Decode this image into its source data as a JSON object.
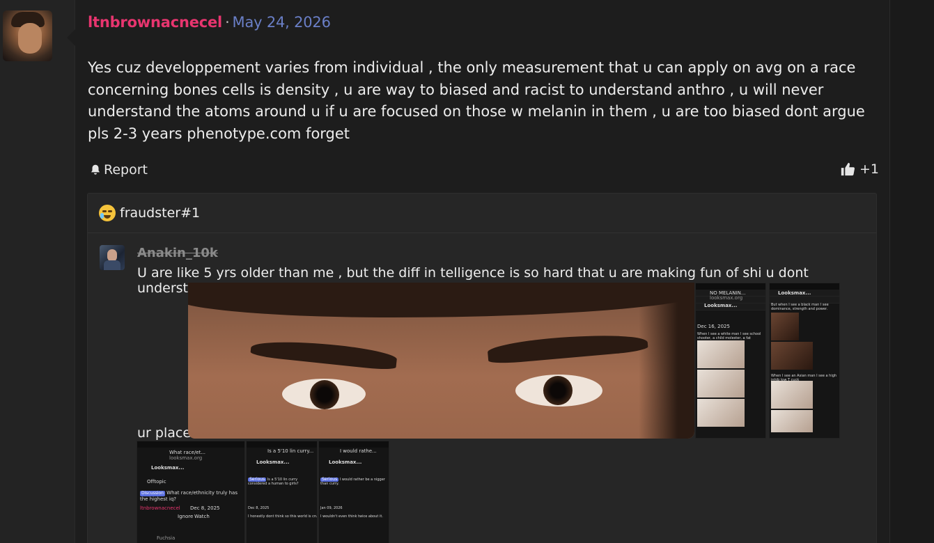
{
  "post": {
    "username": "ltnbrownacnecel",
    "separator": "·",
    "date": "May 24, 2026",
    "body": "Yes cuz developpement varies from individual , the only measurement that u can apply on avg on a race concerning bones cells is density , u are way to biased and racist to understand anthro , u will never understand the atoms around u if u are focused on those w melanin in them , u are too biased dont argue pls 2-3 years phenotype.com forget",
    "report_label": "Report",
    "like_count": "+1"
  },
  "quote": {
    "title": "fraudster#1",
    "author": "Anakin_10k",
    "text_line1": "U are like 5 yrs older than me , but the diff in telligence is so hard that u are making fun of shi u dont understand , know",
    "text_line2": "ur place"
  },
  "screenshots": {
    "p1": {
      "title": "NO MELANIN...",
      "site": "looksmax.org",
      "logo": "Looksmax...",
      "date": "Dec 16, 2025",
      "caption": "When I see a white man I see school shooter, a child molester, a fat disgusting cuck"
    },
    "p2": {
      "logo": "Looksmax...",
      "caption1": "But when I see a black man I see dominance, strength and power.",
      "caption2": "When I see an Asian man I see a high inhib low T cuck"
    },
    "p3": {
      "title": "What race/et...",
      "site": "looksmax.org",
      "logo": "Looksmax...",
      "back": "Offtopic",
      "tag": "Discussion",
      "thread": "What race/ethnicity truly has the highest iq?",
      "date": "Dec 8, 2025",
      "ignore": "Ignore",
      "watch": "Watch",
      "user": "ltnbrownacnecel",
      "rank": "Fuchsia"
    },
    "p4": {
      "title": "Is a 5'10 lin curry...",
      "logo": "Looksmax...",
      "tag": "Serious",
      "thread": "Is a 5'10 lin curry considered a human to girls?",
      "date": "Dec 8, 2025",
      "body": "I honestly dont think so this world is cruel bruh."
    },
    "p5": {
      "title": "I would rathe...",
      "logo": "Looksmax...",
      "tag": "Serious",
      "thread": "I would rather be a nigger than curry.",
      "date": "Jan 09, 2026",
      "body": "I wouldn't even think twice about it."
    }
  },
  "colors": {
    "username": "#e8356f",
    "date": "#6a7fc7",
    "background": "#1d1d1d"
  }
}
